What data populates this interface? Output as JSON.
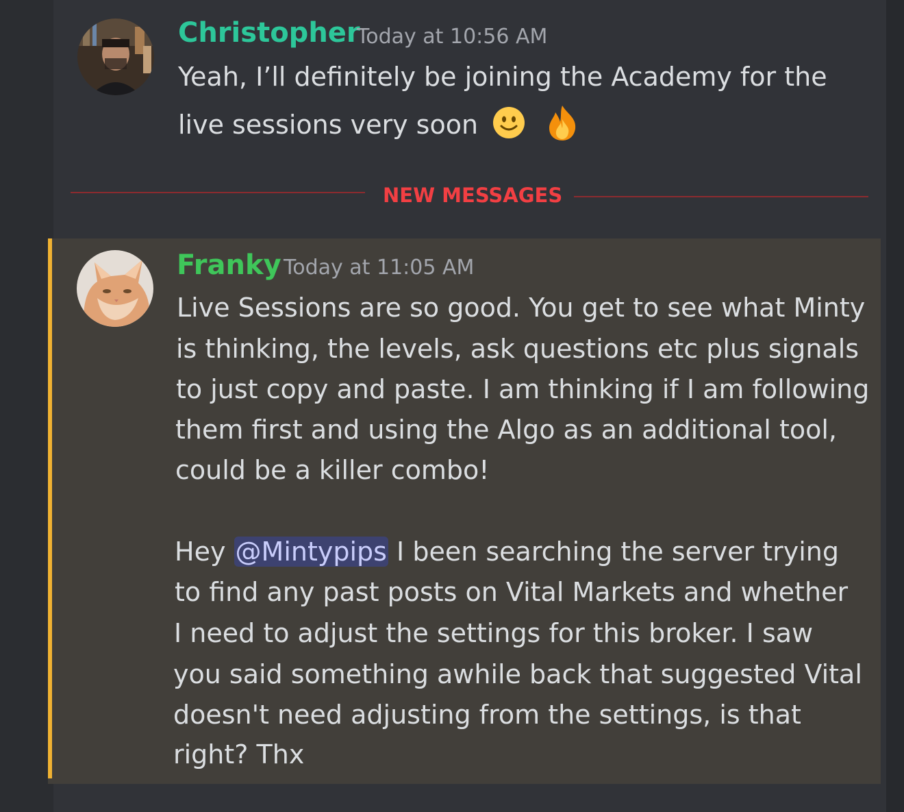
{
  "messages": [
    {
      "author": "Christopher",
      "author_color": "#2dc79a",
      "timestamp": "Today at 10:56 AM",
      "lines": [
        "Yeah, I’ll definitely be joining the Academy for the",
        "live sessions very soon"
      ],
      "emojis": [
        "slightly-smiling-face-icon",
        "fire-icon"
      ]
    },
    {
      "author": "Franky",
      "author_color": "#3fc65a",
      "timestamp": "Today at 11:05 AM",
      "lines": [
        "Live Sessions are so good. You get to see what Minty",
        "is thinking, the levels, ask questions etc plus signals",
        "to just copy and paste. I am thinking if I am following",
        "them first and using the Algo as an additional tool,",
        "could be a killer combo!"
      ],
      "mention_prefix": "Hey ",
      "mention": "@Mintypips",
      "mention_suffix": " I been searching the server trying",
      "lines2": [
        "to find any past posts on Vital Markets and whether",
        "I need to adjust the settings for this broker. I saw",
        "you said something awhile back that suggested Vital",
        "doesn't need adjusting from the settings, is that",
        "right? Thx"
      ]
    }
  ],
  "divider": {
    "label": "NEW MESSAGES",
    "color": "#f23f43"
  },
  "colors": {
    "background": "#313338",
    "highlight": "#423f3a",
    "highlight_bar": "#f0b232",
    "mention_bg": "#3d4270"
  }
}
